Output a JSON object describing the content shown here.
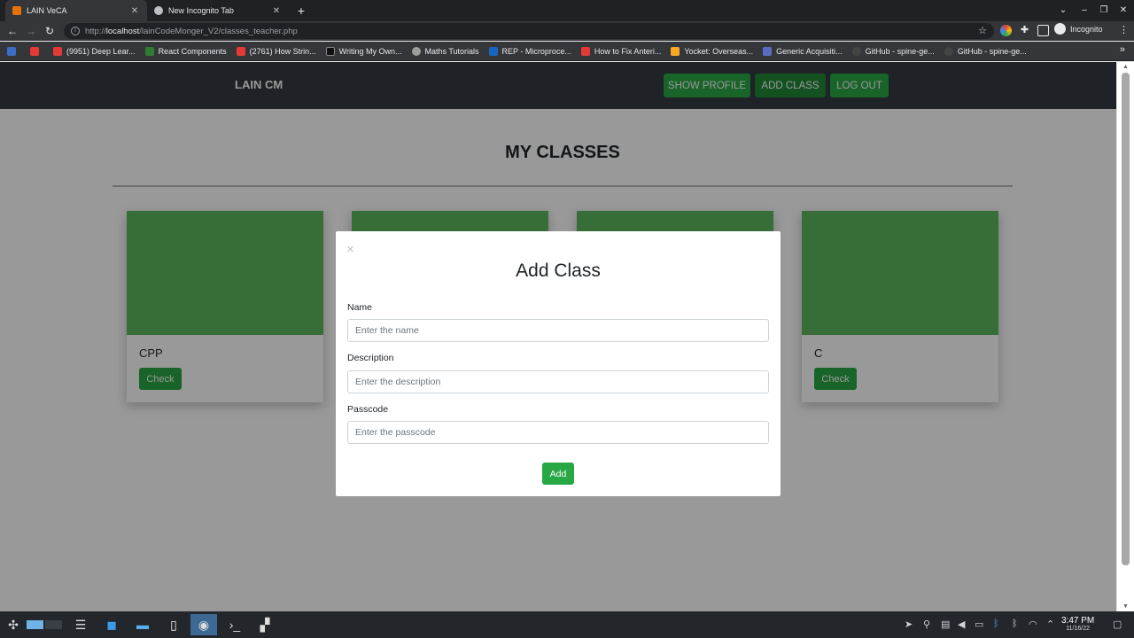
{
  "browser": {
    "tabs": [
      {
        "title": "LAIN VeCA",
        "active": true
      },
      {
        "title": "New Incognito Tab",
        "active": false
      }
    ],
    "new_tab": "+",
    "url_scheme": "http://",
    "url_host": "localhost",
    "url_path": "/lainCodeMonger_V2/classes_teacher.php",
    "profile": "Incognito",
    "bookmarks": [
      {
        "label": "",
        "color": "#3c6cc4"
      },
      {
        "label": "",
        "color": "#e53935"
      },
      {
        "label": "(9951) Deep Lear...",
        "color": "#e53935"
      },
      {
        "label": "React Components",
        "color": "#2e7d32"
      },
      {
        "label": "(2761) How Strin...",
        "color": "#e53935"
      },
      {
        "label": "Writing My Own...",
        "color": "#111111"
      },
      {
        "label": "Maths Tutorials",
        "color": "#9e9e9e"
      },
      {
        "label": "REP - Microproce...",
        "color": "#1565c0"
      },
      {
        "label": "How to Fix Anteri...",
        "color": "#e53935"
      },
      {
        "label": "Yocket: Overseas...",
        "color": "#f9a825"
      },
      {
        "label": "Generic Acquisiti...",
        "color": "#5c6bc0"
      },
      {
        "label": "GitHub - spine-ge...",
        "color": "#444444"
      },
      {
        "label": "GitHub - spine-ge...",
        "color": "#444444"
      }
    ]
  },
  "navbar": {
    "brand": "LAIN CM",
    "show_profile": "SHOW PROFILE",
    "add_class": "ADD CLASS",
    "log_out": "LOG OUT"
  },
  "page": {
    "heading": "MY CLASSES",
    "cards": [
      {
        "title": "CPP",
        "button": "Check"
      },
      {
        "title": "",
        "button": ""
      },
      {
        "title": "",
        "button": ""
      },
      {
        "title": "C",
        "button": "Check"
      }
    ]
  },
  "modal": {
    "close": "×",
    "title": "Add Class",
    "name_label": "Name",
    "name_placeholder": "Enter the name",
    "description_label": "Description",
    "description_placeholder": "Enter the description",
    "passcode_label": "Passcode",
    "passcode_placeholder": "Enter the passcode",
    "add_button": "Add"
  },
  "taskbar": {
    "time": "3:47 PM",
    "date": "11/16/22"
  },
  "colors": {
    "primary_green": "#28a745",
    "card_green": "#5cb85c",
    "navbar_dark": "#343a40"
  }
}
